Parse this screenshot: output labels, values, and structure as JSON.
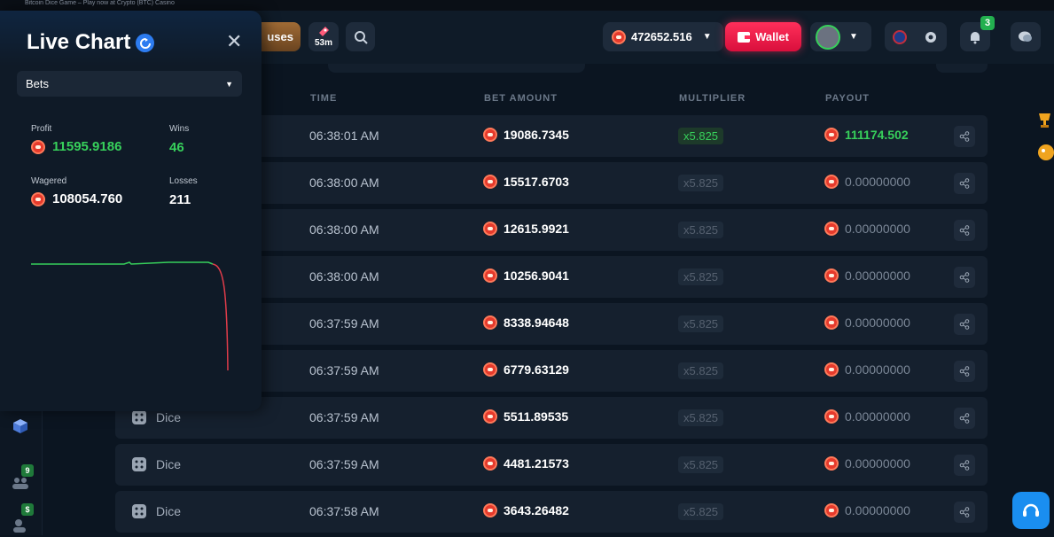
{
  "window_title": "Bitcoin Dice Game – Play now at Crypto (BTC) Casino",
  "header": {
    "bonuses_label": "uses",
    "rakeback_timer": "53m",
    "balance": "472652.516",
    "wallet_label": "Wallet",
    "notification_count": "3"
  },
  "rail": {
    "badge_1": "9",
    "badge_2": "$"
  },
  "panel": {
    "title": "Live Chart",
    "select_value": "Bets",
    "profit_label": "Profit",
    "profit_value": "11595.9186",
    "wins_label": "Wins",
    "wins_value": "46",
    "wagered_label": "Wagered",
    "wagered_value": "108054.760",
    "losses_label": "Losses",
    "losses_value": "211"
  },
  "table": {
    "columns": [
      "TIME",
      "BET AMOUNT",
      "MULTIPLIER",
      "PAYOUT"
    ],
    "rows": [
      {
        "game": "",
        "time": "06:38:01 AM",
        "bet": "19086.7345",
        "mult": "x5.825",
        "payout": "111174.502",
        "win": true
      },
      {
        "game": "",
        "time": "06:38:00 AM",
        "bet": "15517.6703",
        "mult": "x5.825",
        "payout": "0.00000000",
        "win": false
      },
      {
        "game": "",
        "time": "06:38:00 AM",
        "bet": "12615.9921",
        "mult": "x5.825",
        "payout": "0.00000000",
        "win": false
      },
      {
        "game": "",
        "time": "06:38:00 AM",
        "bet": "10256.9041",
        "mult": "x5.825",
        "payout": "0.00000000",
        "win": false
      },
      {
        "game": "",
        "time": "06:37:59 AM",
        "bet": "8338.94648",
        "mult": "x5.825",
        "payout": "0.00000000",
        "win": false
      },
      {
        "game": "",
        "time": "06:37:59 AM",
        "bet": "6779.63129",
        "mult": "x5.825",
        "payout": "0.00000000",
        "win": false
      },
      {
        "game": "Dice",
        "time": "06:37:59 AM",
        "bet": "5511.89535",
        "mult": "x5.825",
        "payout": "0.00000000",
        "win": false
      },
      {
        "game": "Dice",
        "time": "06:37:59 AM",
        "bet": "4481.21573",
        "mult": "x5.825",
        "payout": "0.00000000",
        "win": false
      },
      {
        "game": "Dice",
        "time": "06:37:58 AM",
        "bet": "3643.26482",
        "mult": "x5.825",
        "payout": "0.00000000",
        "win": false
      }
    ]
  },
  "colors": {
    "accent": "#2d7cf0",
    "win": "#37d05b",
    "loss": "#e03c4a",
    "wallet": "#ff2f5a"
  }
}
